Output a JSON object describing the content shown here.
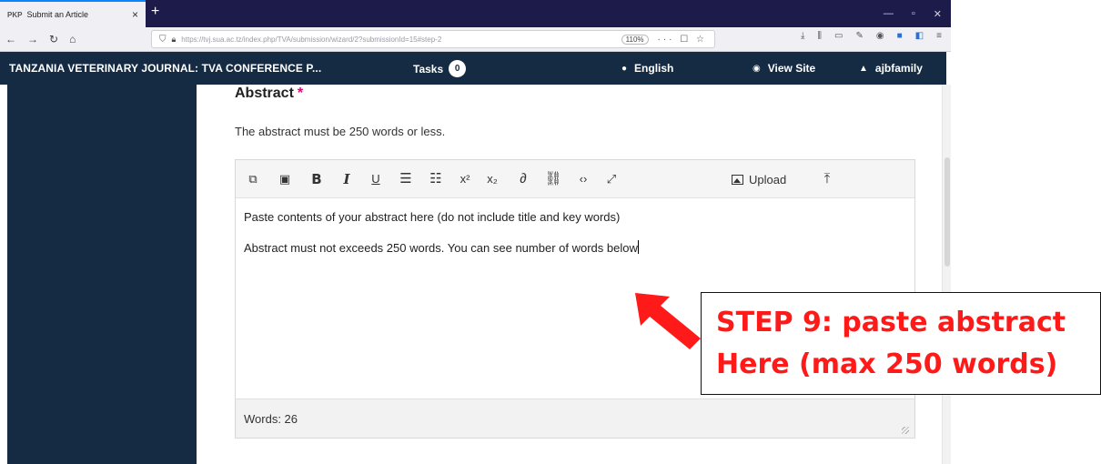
{
  "browser": {
    "tab_title": "Submit an Article",
    "tab_favicon": "PKP",
    "url": "https://tvj.sua.ac.tz/index.php/TVA/submission/wizard/2?submissionId=15#step-2",
    "zoom": "110%",
    "page_actions": "··· ☐ ☆"
  },
  "header": {
    "journal_title": "TANZANIA VETERINARY JOURNAL: TVA CONFERENCE P...",
    "tasks_label": "Tasks",
    "tasks_count": "0",
    "language": "English",
    "view_site": "View Site",
    "user": "ajbfamily"
  },
  "form": {
    "abstract_label": "Abstract",
    "required_mark": "*",
    "description": "The abstract must be 250 words or less.",
    "toolbar": {
      "upload_label": "Upload"
    },
    "editor_lines": [
      "Paste contents of your abstract here (do not include title and key words)",
      "Abstract must not exceeds 250 words. You can see number of words below"
    ],
    "word_count": "Words: 26"
  },
  "annotation": {
    "line1": "STEP 9: paste abstract",
    "line2": "Here (max 250 words)",
    "color": "#ff1a1a"
  },
  "icons": {
    "copy": "copy-icon",
    "paste": "paste-icon",
    "bold": "bold-icon",
    "italic": "italic-icon",
    "underline": "underline-icon",
    "bullet_list": "bullet-list-icon",
    "numbered_list": "numbered-list-icon",
    "superscript": "superscript-icon",
    "subscript": "subscript-icon",
    "link": "link-icon",
    "unlink": "unlink-icon",
    "code": "code-icon",
    "fullscreen": "fullscreen-icon",
    "image": "image-icon",
    "upload": "upload-icon"
  },
  "colors": {
    "header_bg": "#142b43",
    "required": "#d00b6e"
  }
}
